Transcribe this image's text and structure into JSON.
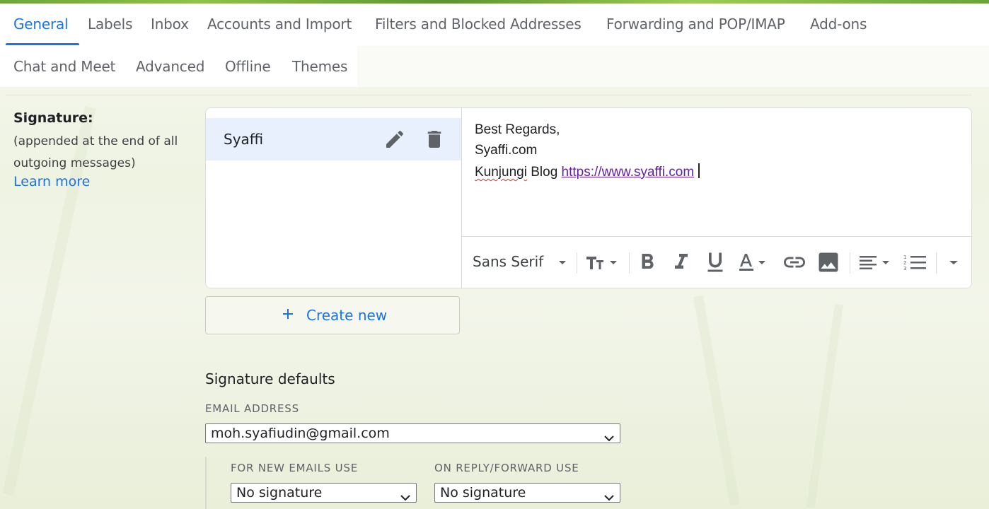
{
  "tabs": {
    "row1": [
      "General",
      "Labels",
      "Inbox",
      "Accounts and Import",
      "Filters and Blocked Addresses",
      "Forwarding and POP/IMAP",
      "Add-ons"
    ],
    "row2": [
      "Chat and Meet",
      "Advanced",
      "Offline",
      "Themes"
    ],
    "active": "General"
  },
  "signature_section": {
    "label": "Signature:",
    "description": "(appended at the end of all outgoing messages)",
    "learn_more": "Learn more"
  },
  "signatures": [
    {
      "name": "Syaffi",
      "selected": true
    }
  ],
  "editor": {
    "line1": "Best Regards,",
    "line2": "Syaffi.com",
    "line3_word1": "Kunjungi",
    "line3_word2": " Blog ",
    "line3_link": "https://www.syaffi.com"
  },
  "toolbar": {
    "font": "Sans Serif",
    "buttons": [
      "text-size",
      "bold",
      "italic",
      "underline",
      "text-color",
      "link",
      "image",
      "align",
      "numbered-list",
      "more"
    ]
  },
  "create_new": "Create new",
  "defaults": {
    "title": "Signature defaults",
    "email_label": "EMAIL ADDRESS",
    "email_value": "moh.syafiudin@gmail.com",
    "new_label": "FOR NEW EMAILS USE",
    "new_value": "No signature",
    "reply_label": "ON REPLY/FORWARD USE",
    "reply_value": "No signature"
  },
  "colors": {
    "accent": "#1a73e8",
    "link_visited": "#681da8",
    "selected_bg": "#e8f0fe"
  }
}
